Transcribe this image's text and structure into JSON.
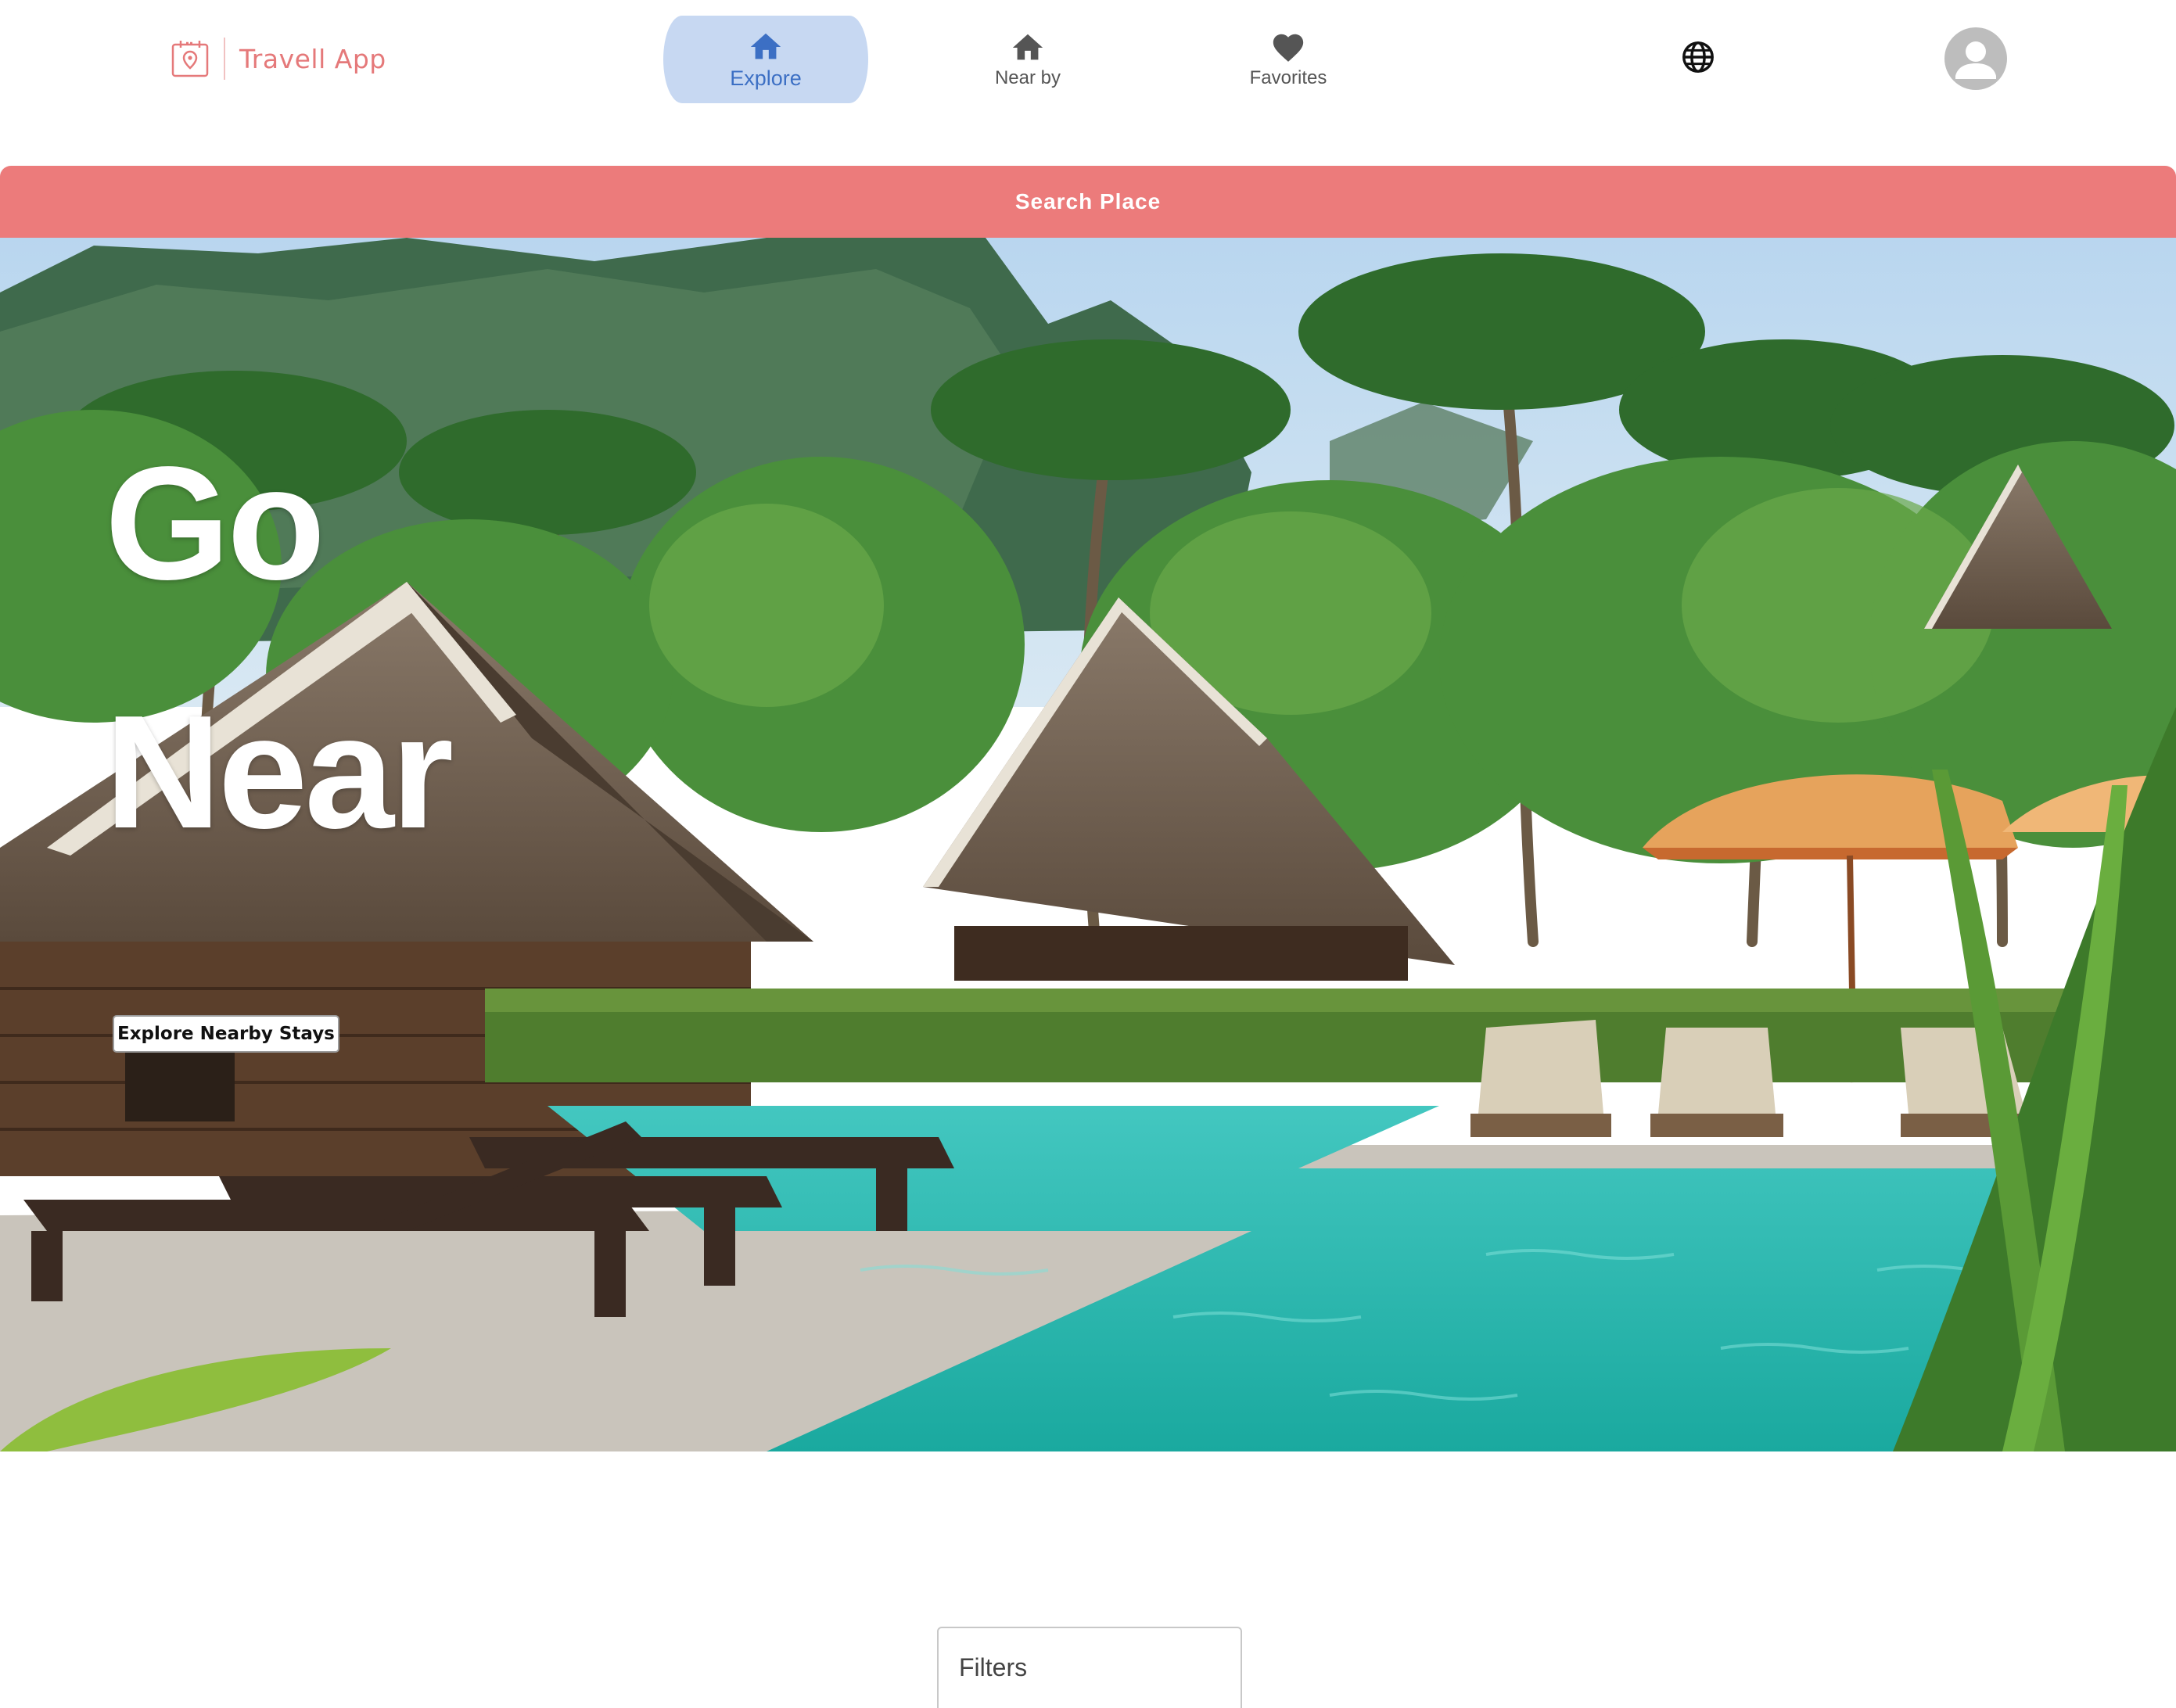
{
  "header": {
    "brand_name": "Travell App",
    "tabs": [
      {
        "label": "Explore",
        "icon": "home-icon",
        "active": true
      },
      {
        "label": "Near by",
        "icon": "home-icon",
        "active": false
      },
      {
        "label": "Favorites",
        "icon": "heart-icon",
        "active": false
      }
    ],
    "language_icon": "globe-icon",
    "profile_icon": "account-circle-icon"
  },
  "search": {
    "label": "Search Place"
  },
  "hero": {
    "line1": "Go",
    "line2": "Near",
    "cta_label": "Explore Nearby Stays",
    "image": "tropical-resort-pool-photo"
  },
  "filters": {
    "label": "Filters"
  },
  "colors": {
    "brand": "#e5797a",
    "search_bar": "#ec7b7b",
    "active_tab_bg": "#c7d8f2",
    "active_tab_text": "#3c6fc4",
    "inactive_tab_text": "#555555",
    "pool_water": "#2ec4b6"
  }
}
